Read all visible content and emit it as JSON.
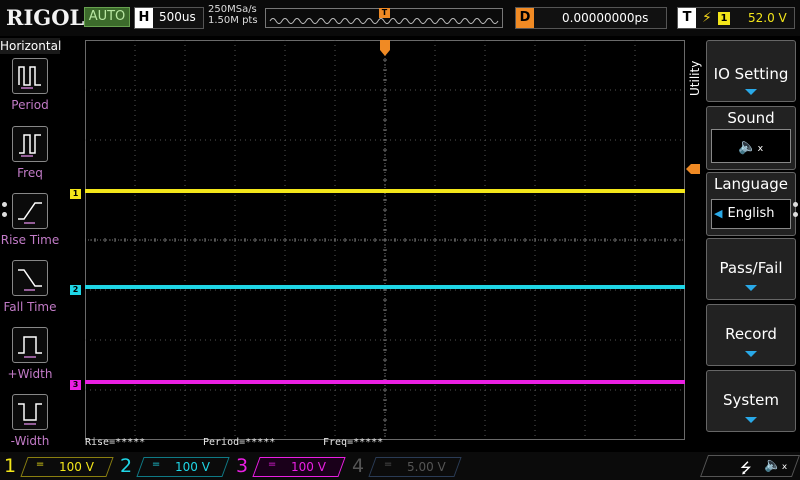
{
  "header": {
    "brand": "RIGOL",
    "mode": "AUTO",
    "timebase": {
      "label": "H",
      "value": "500us"
    },
    "sample_rate": "250MSa/s",
    "memory_depth": "1.50M pts",
    "trigger_marker": "T",
    "delay": {
      "label": "D",
      "value": "0.00000000ps"
    },
    "trigger": {
      "label": "T",
      "edge_icon": "rising-edge-icon",
      "source": "1",
      "level": "52.0 V"
    }
  },
  "left_menu": {
    "title": "Horizontal",
    "items": [
      {
        "label": "Period",
        "icon": "period-icon"
      },
      {
        "label": "Freq",
        "icon": "freq-icon"
      },
      {
        "label": "Rise Time",
        "icon": "rise-time-icon"
      },
      {
        "label": "Fall Time",
        "icon": "fall-time-icon"
      },
      {
        "label": "+Width",
        "icon": "positive-width-icon"
      },
      {
        "label": "-Width",
        "icon": "negative-width-icon"
      }
    ]
  },
  "waveform": {
    "markers": {
      "ch1": "1",
      "ch2": "2",
      "ch3": "3",
      "trigger": "T"
    },
    "colors": {
      "ch1": "#f3e61a",
      "ch2": "#1fd6e6",
      "ch3": "#ea1fe3",
      "ch4": "#2a6bc4",
      "trigger": "#f08a24"
    }
  },
  "measurements": {
    "rise": "Rise=*****",
    "period": "Period=*****",
    "freq": "Freq=*****"
  },
  "right_menu": {
    "tab": "Utility",
    "items": [
      {
        "label": "IO Setting"
      },
      {
        "label": "Sound",
        "sub_icon": "speaker-muted-icon"
      },
      {
        "label": "Language",
        "value": "English"
      },
      {
        "label": "Pass/Fail"
      },
      {
        "label": "Record"
      },
      {
        "label": "System"
      }
    ]
  },
  "channels": [
    {
      "num": "1",
      "coupling": "=",
      "scale": "100 V",
      "color": "#f3e61a"
    },
    {
      "num": "2",
      "coupling": "=",
      "scale": "100 V",
      "color": "#1fd6e6"
    },
    {
      "num": "3",
      "coupling": "=",
      "scale": "100 V",
      "color": "#ea1fe3"
    },
    {
      "num": "4",
      "coupling": "=",
      "scale": "5.00 V",
      "color": "#666666"
    }
  ],
  "status_icons": [
    "usb-icon",
    "speaker-muted-icon"
  ]
}
